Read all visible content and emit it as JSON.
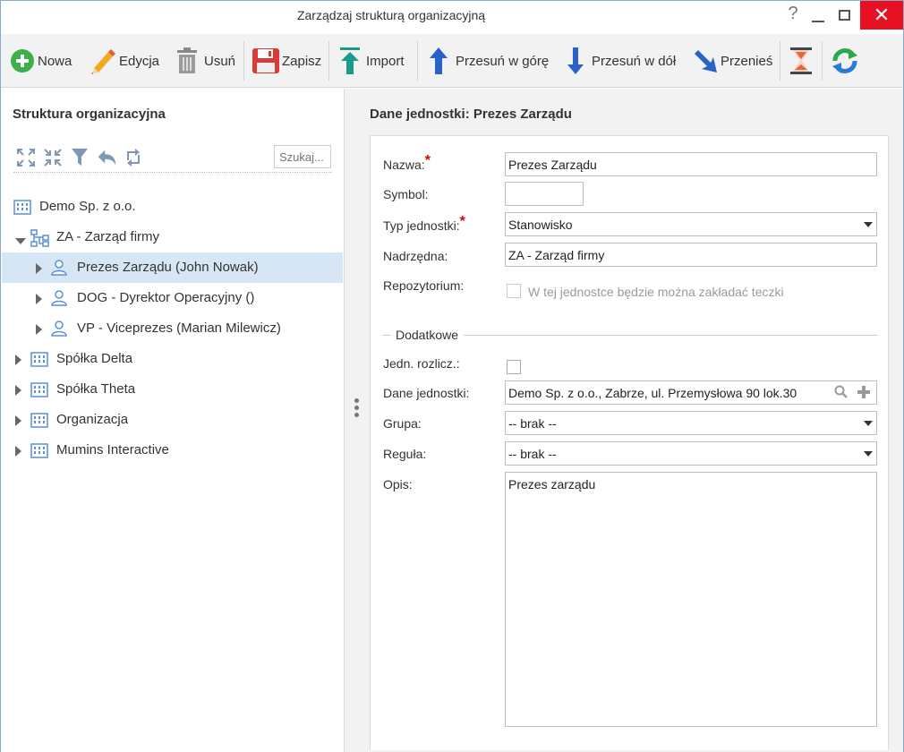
{
  "window": {
    "title": "Zarządzaj strukturą organizacyjną",
    "help_symbol": "?",
    "close_symbol": "✕"
  },
  "toolbar": {
    "new_label": "Nowa",
    "edit_label": "Edycja",
    "delete_label": "Usuń",
    "save_label": "Zapisz",
    "import_label": "Import",
    "move_up_label": "Przesuń w górę",
    "move_down_label": "Przesuń w dół",
    "move_label": "Przenieś"
  },
  "tree_panel": {
    "title": "Struktura organizacyjna",
    "search_placeholder": "Szukaj...",
    "items": [
      {
        "label": "Demo Sp. z o.o.",
        "icon": "building-icon",
        "level": 0,
        "expander": "none"
      },
      {
        "label": "ZA - Zarząd firmy",
        "icon": "org-chart-icon",
        "level": 0,
        "expander": "expanded"
      },
      {
        "label": "Prezes Zarządu (John Nowak)",
        "icon": "person-icon",
        "level": 1,
        "expander": "collapsed",
        "selected": true
      },
      {
        "label": "DOG - Dyrektor Operacyjny ()",
        "icon": "person-icon",
        "level": 1,
        "expander": "collapsed"
      },
      {
        "label": "VP - Viceprezes (Marian Milewicz)",
        "icon": "person-icon",
        "level": 1,
        "expander": "collapsed"
      },
      {
        "label": "Spółka Delta",
        "icon": "building-icon",
        "level": 0,
        "expander": "collapsed"
      },
      {
        "label": "Spółka Theta",
        "icon": "building-icon",
        "level": 0,
        "expander": "collapsed"
      },
      {
        "label": "Organizacja",
        "icon": "building-icon",
        "level": 0,
        "expander": "collapsed"
      },
      {
        "label": "Mumins Interactive",
        "icon": "building-icon",
        "level": 0,
        "expander": "collapsed"
      }
    ]
  },
  "details": {
    "title": "Dane jednostki: Prezes Zarządu",
    "name_label": "Nazwa:",
    "name_value": "Prezes Zarządu",
    "symbol_label": "Symbol:",
    "symbol_value": "",
    "type_label": "Typ jednostki:",
    "type_value": "Stanowisko",
    "parent_label": "Nadrzędna:",
    "parent_value": "ZA - Zarząd firmy",
    "repo_label": "Repozytorium:",
    "repo_checkbox_label": "W tej jednostce będzie można zakładać teczki",
    "required_mark": "*",
    "additional_legend": "Dodatkowe",
    "billing_label": "Jedn. rozlicz.:",
    "unit_data_label": "Dane jednostki:",
    "unit_data_value": "Demo Sp. z o.o., Zabrze, ul. Przemysłowa 90 lok.30",
    "group_label": "Grupa:",
    "group_value": "-- brak --",
    "rule_label": "Reguła:",
    "rule_value": "-- brak --",
    "desc_label": "Opis:",
    "desc_value": "Prezes zarządu"
  },
  "colors": {
    "selected_row": "#d6e6f5",
    "close_button": "#e81123",
    "required": "#dd0000",
    "icon_blue": "#5b8fd6"
  }
}
